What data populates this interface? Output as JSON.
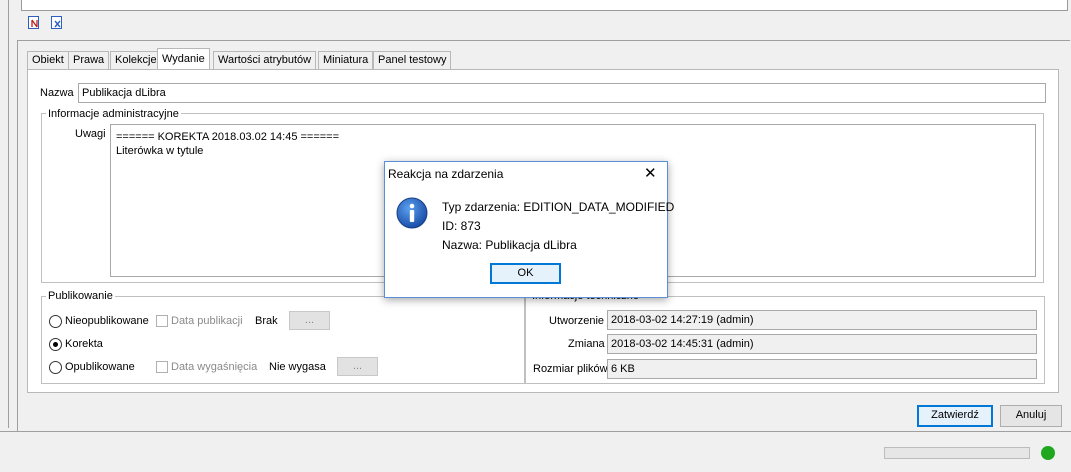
{
  "toolbar": {
    "icons": [
      "document-red-icon",
      "document-x-icon"
    ]
  },
  "tabs": [
    {
      "label": "Obiekt"
    },
    {
      "label": "Prawa"
    },
    {
      "label": "Kolekcje"
    },
    {
      "label": "Wydanie"
    },
    {
      "label": "Wartości atrybutów"
    },
    {
      "label": "Miniatura"
    },
    {
      "label": "Panel testowy"
    }
  ],
  "edition": {
    "name_label": "Nazwa",
    "name_value": "Publikacja dLibra",
    "admin_group_title": "Informacje administracyjne",
    "notes_label": "Uwagi",
    "notes_line1": "====== KOREKTA 2018.03.02 14:45 ======",
    "notes_line2": "Literówka w tytule"
  },
  "publishing": {
    "title": "Publikowanie",
    "unpublished_label": "Nieopublikowane",
    "pub_date_label": "Data publikacji",
    "pub_date_value": "Brak",
    "correction_label": "Korekta",
    "published_label": "Opublikowane",
    "expiry_label": "Data wygaśnięcia",
    "expiry_value": "Nie wygasa",
    "ellipsis": "...",
    "selected": "Korekta"
  },
  "tech": {
    "title": "Informacje techniczne",
    "created_label": "Utworzenie",
    "created_value": "2018-03-02 14:27:19 (admin)",
    "modified_label": "Zmiana",
    "modified_value": "2018-03-02 14:45:31 (admin)",
    "size_label": "Rozmiar plików",
    "size_value": "6 KB"
  },
  "buttons": {
    "confirm": "Zatwierdź",
    "cancel": "Anuluj"
  },
  "dialog": {
    "title": "Reakcja na zdarzenia",
    "close_glyph": "✕",
    "line1": "Typ zdarzenia: EDITION_DATA_MODIFIED",
    "line2": "ID: 873",
    "line3": "Nazwa: Publikacja dLibra",
    "ok": "OK",
    "icon": "info-icon"
  },
  "status": {
    "indicator_color": "#1fa81f",
    "accent": "#0078d7"
  }
}
